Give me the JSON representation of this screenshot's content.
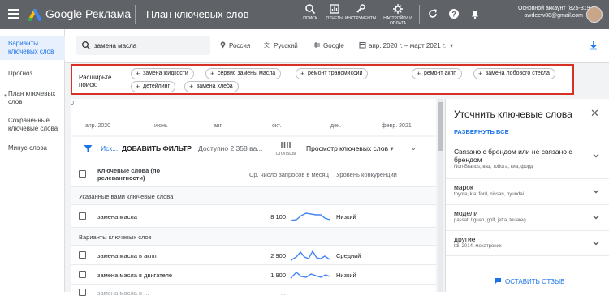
{
  "header": {
    "brand": "Google Реклама",
    "title": "План ключевых слов",
    "tools": [
      {
        "label": "ПОИСК",
        "icon": "search-icon"
      },
      {
        "label": "ОТЧЕТЫ",
        "icon": "reports-icon"
      },
      {
        "label": "ИНСТРУМЕНТЫ",
        "icon": "tools-icon"
      },
      {
        "label": "НАСТРОЙКИ И ОПЛАТА",
        "icon": "settings-icon"
      }
    ],
    "account_name": "Основной аккаунт (825-319-5...",
    "account_email": "awdeew88@gmail.com"
  },
  "sidebar": {
    "items": [
      {
        "label": "Варианты ключевых слов",
        "active": true
      },
      {
        "label": "Прогноз"
      },
      {
        "label": "План ключевых слов"
      },
      {
        "label": "Сохраненные ключевые слова"
      },
      {
        "label": "Минус-слова"
      }
    ]
  },
  "search": {
    "query": "замена масла",
    "location": "Россия",
    "language": "Русский",
    "network": "Google",
    "date_range": "апр. 2020 г. – март 2021 г."
  },
  "expand_search": {
    "label": "Расширьте поиск:",
    "chips": [
      "замена жидкости",
      "сервис замены масла",
      "ремонт трансмиссии",
      "ремонт акпп",
      "замена лобового стекла",
      "детейлинг",
      "замена хлеба"
    ]
  },
  "timeline": {
    "zero": "0",
    "labels": [
      "апр. 2020",
      "июнь",
      "авг.",
      "окт.",
      "дек.",
      "февр. 2021"
    ]
  },
  "toolbar": {
    "search_short": "Иск...",
    "add_filter": "ДОБАВИТЬ ФИЛЬТР",
    "available": "Доступно 2 358 вa...",
    "columns": "СТОЛБЦЫ",
    "view": "Просмотр ключевых слов"
  },
  "table": {
    "headers": {
      "keyword": "Ключевые слова (по релевантности)",
      "searches": "Ср. число запросов в месяц",
      "competition": "Уровень конкуренции"
    },
    "group1": "Указанные вами ключевые слова",
    "group2": "Варианты ключевых слов",
    "rows": [
      {
        "keyword": "замена масла",
        "searches": "8 100",
        "competition": "Низкий"
      },
      {
        "keyword": "замена масла в акпп",
        "searches": "2 900",
        "competition": "Средний"
      },
      {
        "keyword": "замена масла в двигателе",
        "searches": "1 900",
        "competition": "Низкий"
      },
      {
        "keyword": "замена масла в ...",
        "searches": "...",
        "competition": ""
      }
    ]
  },
  "panel": {
    "title": "Уточнить ключевые слова",
    "expand_all": "РАЗВЕРНУТЬ ВСЕ",
    "items": [
      {
        "title": "Связано с брендом или не связано с брендом",
        "sub": "Non-Brands, ваз, тойота, киа, форд"
      },
      {
        "title": "марок",
        "sub": "toyota, kia, ford, nissan, hyundai"
      },
      {
        "title": "модели",
        "sub": "passat, tiguan, golf, jetta, touareg"
      },
      {
        "title": "другие",
        "sub": "tdi, 2014, мехатроник"
      }
    ],
    "feedback": "ОСТАВИТЬ ОТЗЫВ"
  },
  "colors": {
    "accent": "#1a73e8",
    "header_bg": "#5f6368",
    "highlight_border": "#d93025"
  }
}
